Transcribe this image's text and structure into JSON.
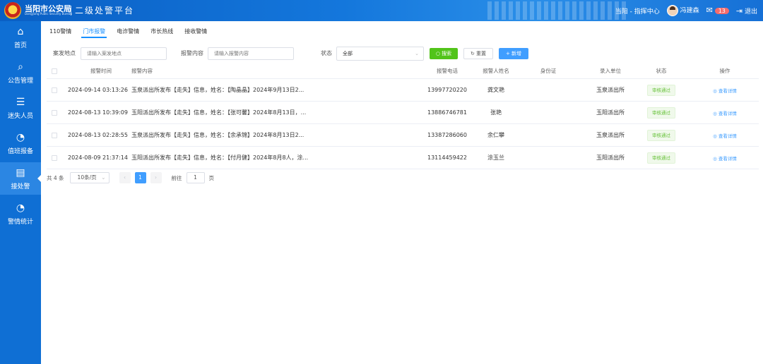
{
  "header": {
    "org_name": "当阳市公安局",
    "org_name_en": "Dangyang Public Security Bureau",
    "platform_name": "二级处警平台",
    "location": "当阳 - 指挥中心",
    "user_name": "冯建森",
    "message_count": "13",
    "logout_label": "退出"
  },
  "sidebar": {
    "items": [
      {
        "label": "首页",
        "icon": "home-icon"
      },
      {
        "label": "公告管理",
        "icon": "search-icon"
      },
      {
        "label": "迷失人员",
        "icon": "list-icon"
      },
      {
        "label": "值班报备",
        "icon": "pie-icon"
      },
      {
        "label": "接处警",
        "icon": "document-icon"
      },
      {
        "label": "警情统计",
        "icon": "pie-icon"
      }
    ],
    "active_index": 4
  },
  "tabs": [
    {
      "label": "110警情"
    },
    {
      "label": "门市报警"
    },
    {
      "label": "电诈警情"
    },
    {
      "label": "市长热线"
    },
    {
      "label": "接收警情"
    }
  ],
  "active_tab": 1,
  "filters": {
    "location_label": "案发地点",
    "location_placeholder": "请输入案发地点",
    "content_label": "报警内容",
    "content_placeholder": "请输入报警内容",
    "status_label": "状态",
    "status_value": "全部",
    "search_btn": "搜索",
    "reset_btn": "重置",
    "add_btn": "新增"
  },
  "table": {
    "columns": [
      "报警时间",
      "报警内容",
      "报警电话",
      "报警人姓名",
      "身份证",
      "录入单位",
      "状态",
      "操作"
    ],
    "rows": [
      {
        "time": "2024-09-14 03:13:26",
        "content": "玉泉派出所发布【走失】信息，姓名：【陶晶晶】2024年9月13日2...",
        "phone": "13997720220",
        "name": "龚文艳",
        "id_card": "",
        "unit": "玉泉派出所",
        "status": "审核通过",
        "action": "查看详情"
      },
      {
        "time": "2024-08-13 10:39:09",
        "content": "玉阳派出所发布【走失】信息，姓名：【张可馨】2024年8月13日，...",
        "phone": "13886746781",
        "name": "张艳",
        "id_card": "",
        "unit": "玉阳派出所",
        "status": "审核通过",
        "action": "查看详情"
      },
      {
        "time": "2024-08-13 02:28:55",
        "content": "玉泉派出所发布【走失】信息，姓名：【余承锦】2024年8月13日2...",
        "phone": "13387286060",
        "name": "余仁攀",
        "id_card": "",
        "unit": "玉泉派出所",
        "status": "审核通过",
        "action": "查看详情"
      },
      {
        "time": "2024-08-09 21:37:14",
        "content": "玉阳派出所发布【走失】信息，姓名：【付月健】2024年8月8人，涂...",
        "phone": "13114459422",
        "name": "涂玉兰",
        "id_card": "",
        "unit": "玉阳派出所",
        "status": "审核通过",
        "action": "查看详情"
      }
    ]
  },
  "pager": {
    "total": "共 4 条",
    "page_size": "10条/页",
    "current": "1",
    "goto_label": "前往",
    "goto_value": "1",
    "page_unit": "页"
  }
}
